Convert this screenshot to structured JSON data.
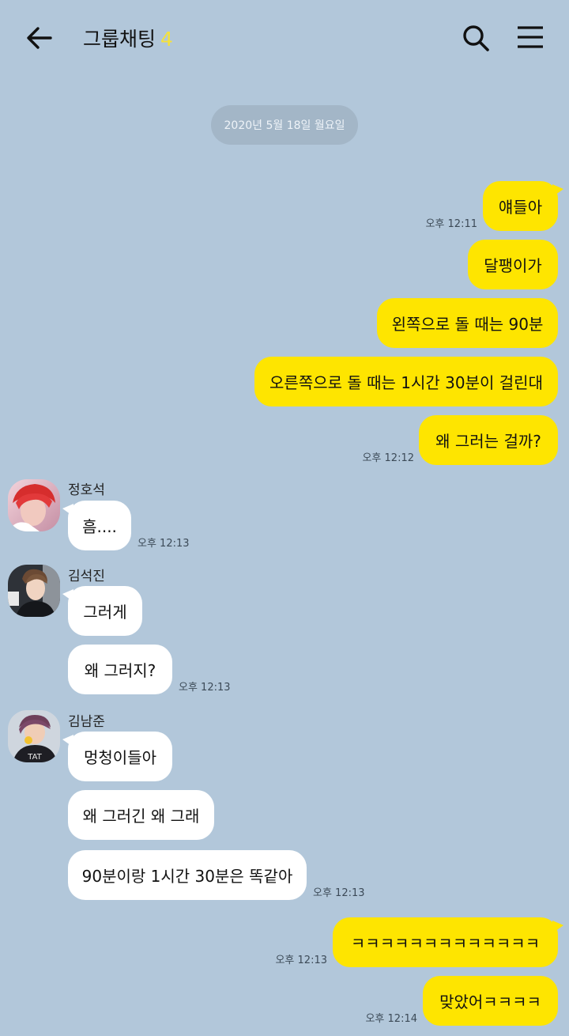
{
  "header": {
    "title": "그룹채팅",
    "member_count": "4"
  },
  "date_divider": "2020년 5월 18일 월요일",
  "messages": [
    {
      "text": "얘들아"
    },
    {
      "text": "달팽이가"
    },
    {
      "text": "왼쪽으로 돌 때는 90분"
    },
    {
      "text": "오른쪽으로 돌 때는 1시간 30분이 걸린대"
    },
    {
      "text": "왜 그러는 걸까?"
    },
    {
      "sender": "정호석",
      "text": "흠...."
    },
    {
      "sender": "김석진",
      "text": "그러게"
    },
    {
      "text": "왜 그러지?"
    },
    {
      "sender": "김남준",
      "text": "멍청이들아"
    },
    {
      "text": "왜 그러긴 왜 그래"
    },
    {
      "text": "90분이랑 1시간 30분은 똑같아"
    },
    {
      "text": "ㅋㅋㅋㅋㅋㅋㅋㅋㅋㅋㅋㅋㅋ"
    },
    {
      "text": "맞았어ㅋㅋㅋㅋ"
    }
  ],
  "times": {
    "t1": "오후 12:11",
    "t2": "오후 12:12",
    "t3": "오후 12:13",
    "t4": "오후 12:13",
    "t5": "오후 12:13",
    "t6": "오후 12:13",
    "t7": "오후 12:14"
  },
  "colors": {
    "background": "#b2c7da",
    "my_bubble": "#fee500",
    "their_bubble": "#ffffff",
    "count_accent": "#f5e23a"
  },
  "icons": {
    "back": "arrow-left-icon",
    "search": "search-icon",
    "menu": "hamburger-menu-icon"
  }
}
